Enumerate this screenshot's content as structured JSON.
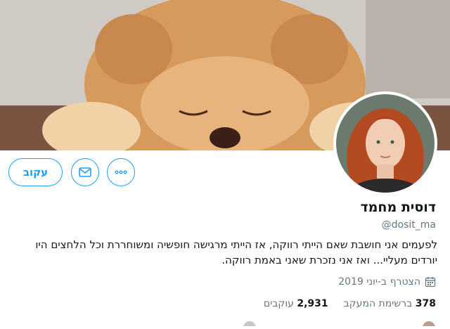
{
  "profile": {
    "name": "דוסית מחמד",
    "handle": "@dosit_ma",
    "bio": "לפעמים אני חושבת שאם הייתי רווקה, אז הייתי מרגישה חופשיה ומשוחררת וכל הלחצים היו יורדים מעליי... ואז אני נזכרת שאני באמת רווקה.",
    "joined": "הצטרף ב-יוני 2019"
  },
  "stats": {
    "following_count": "378",
    "following_label": "ברשימת המעקב",
    "followers_count": "2,931",
    "followers_label": "עוקבים"
  },
  "actions": {
    "follow_label": "עקוב"
  },
  "colors": {
    "accent": "#1da1f2",
    "text": "#14171a",
    "muted": "#657786"
  },
  "icons": {
    "message": "envelope-icon",
    "more": "more-horizontal-icon",
    "calendar": "calendar-icon"
  }
}
